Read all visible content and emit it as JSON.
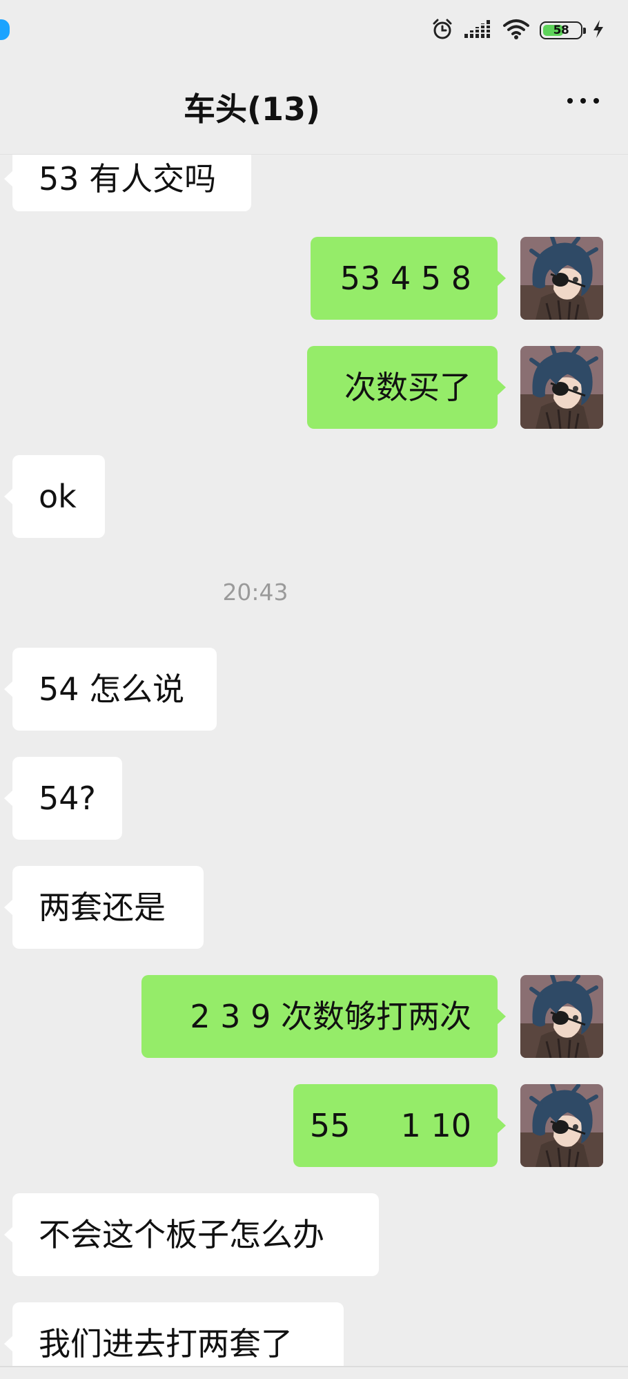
{
  "status_bar": {
    "battery_level": "58",
    "icons": [
      "alarm-clock-icon",
      "signal-icon",
      "wifi-icon",
      "battery-icon",
      "charging-icon"
    ],
    "notification_icon": "qq-icon"
  },
  "header": {
    "title": "车头(13)",
    "more_icon": "more-dots-icon"
  },
  "messages": [
    {
      "side": "left",
      "text": "53 有人交吗"
    },
    {
      "side": "right",
      "text": "53 4 5 8"
    },
    {
      "side": "right",
      "text": "次数买了"
    },
    {
      "side": "left",
      "text": "ok"
    },
    {
      "type": "time",
      "text": "20:43"
    },
    {
      "side": "left",
      "text": "54 怎么说"
    },
    {
      "side": "left",
      "text": "54?"
    },
    {
      "side": "left",
      "text": "两套还是"
    },
    {
      "side": "right",
      "text": "2 3 9 次数够打两次"
    },
    {
      "side": "right",
      "text": "55     1 10"
    },
    {
      "side": "left",
      "text": "不会这个板子怎么办"
    },
    {
      "side": "left",
      "text": "我们进去打两套了"
    }
  ],
  "colors": {
    "background": "#ededed",
    "self_bubble": "#95ec69",
    "other_bubble": "#ffffff",
    "timestamp": "#9a9a9a"
  }
}
